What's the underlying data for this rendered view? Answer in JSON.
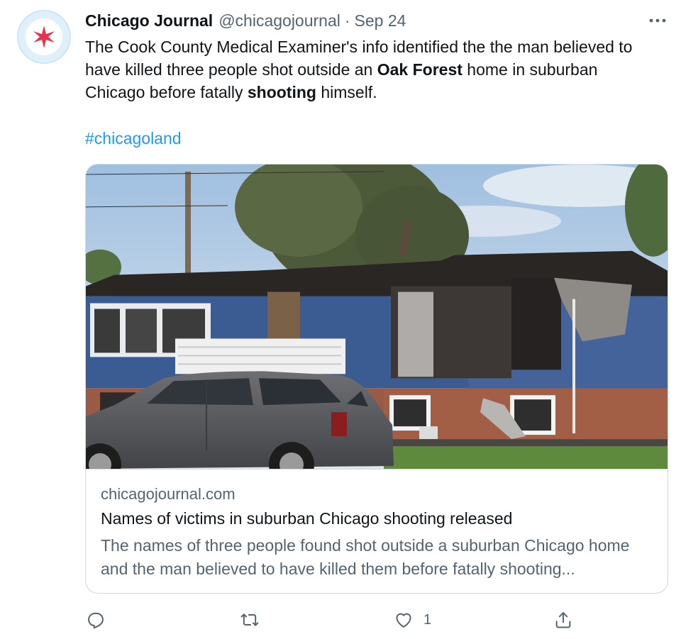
{
  "tweet": {
    "author_name": "Chicago Journal",
    "handle": "@chicagojournal",
    "separator": "·",
    "date": "Sep 24",
    "text_parts": [
      "The Cook County Medical Examiner's info identified the the man believed to have killed three people shot outside an ",
      "Oak Forest",
      " home in suburban Chicago before fatally ",
      "shooting",
      " himself."
    ],
    "hashtag": "#chicagoland"
  },
  "card": {
    "domain": "chicagojournal.com",
    "title": "Names of victims in suburban Chicago shooting released",
    "description": "The names of three people found shot outside a suburban Chicago home and the man believed to have killed them before fatally shooting..."
  },
  "actions": {
    "reply_icon": "reply-icon",
    "retweet_icon": "retweet-icon",
    "like_icon": "heart-icon",
    "like_count": "1",
    "share_icon": "share-icon"
  },
  "colors": {
    "link": "#1d9bf0",
    "secondary_text": "#536471",
    "border": "#cfd9de",
    "avatar_star": "#e8344a"
  }
}
